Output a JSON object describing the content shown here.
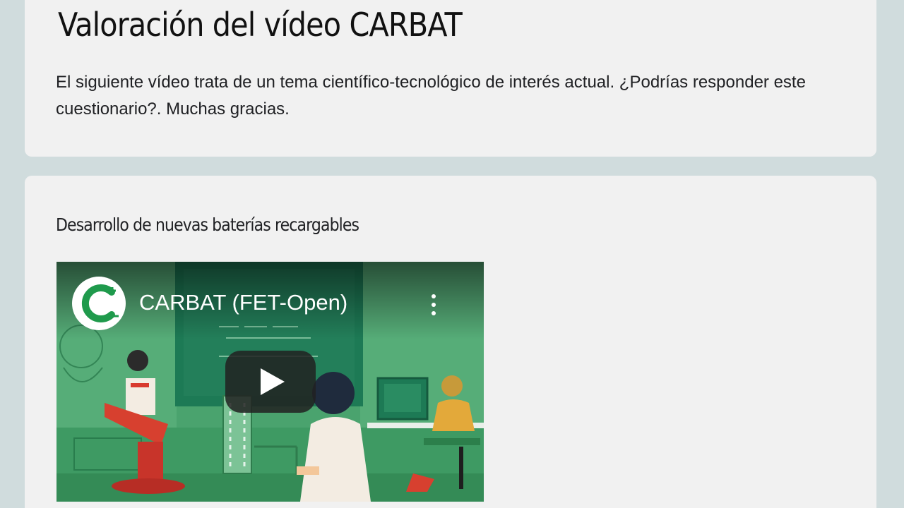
{
  "form": {
    "title": "Valoración del vídeo CARBAT",
    "description": "El siguiente vídeo trata de un tema científico-tecnológico de interés actual. ¿Podrías responder este cuestionario?. Muchas gracias."
  },
  "section": {
    "title": "Desarrollo de nuevas baterías recargables"
  },
  "video": {
    "title": "CARBAT (FET-Open)",
    "channel_logo_icon": "carbat-c-logo-icon",
    "menu_icon": "more-vert-icon",
    "play_icon": "play-icon"
  },
  "colors": {
    "background": "#d0dcdd",
    "card": "#f1f1f1",
    "video_green": "#4aa36e",
    "logo_green": "#1f9a4c"
  }
}
